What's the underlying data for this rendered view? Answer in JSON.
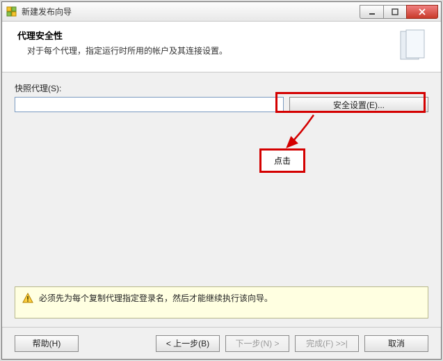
{
  "window": {
    "title": "新建发布向导"
  },
  "header": {
    "title": "代理安全性",
    "subtitle": "对于每个代理，指定运行时所用的帐户及其连接设置。"
  },
  "content": {
    "snapshot_label": "快照代理(S):",
    "snapshot_value": "",
    "security_button": "安全设置(E)..."
  },
  "annotation": {
    "callout": "点击"
  },
  "warning": {
    "text": "必须先为每个复制代理指定登录名，然后才能继续执行该向导。"
  },
  "footer": {
    "help": "帮助(H)",
    "back": "< 上一步(B)",
    "next": "下一步(N) >",
    "finish": "完成(F) >>|",
    "cancel": "取消"
  }
}
